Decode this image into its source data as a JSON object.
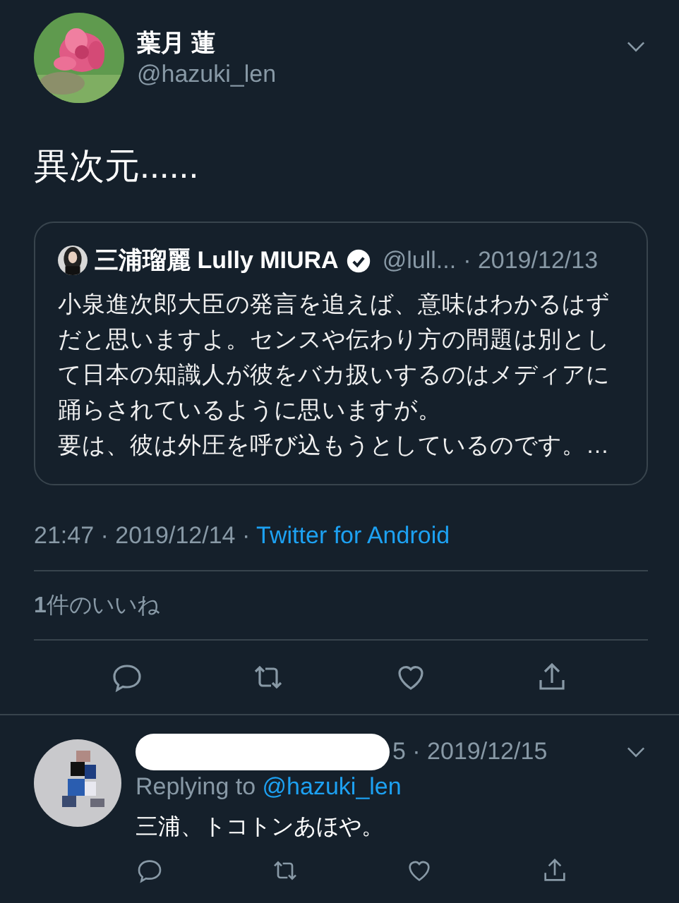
{
  "tweet": {
    "author": {
      "name": "葉月 蓮",
      "handle": "@hazuki_len"
    },
    "text": "異次元......",
    "quoted": {
      "author": "三浦瑠麗 Lully MIURA",
      "verified": true,
      "handle": "@lull...",
      "date": "· 2019/12/13",
      "paragraphs": [
        "小泉進次郎大臣の発言を追えば、意味はわかるはずだと思いますよ。センスや伝わり方の問題は別として日本の知識人が彼をバカ扱いするのはメディアに踊らされているように思いますが。",
        "要は、彼は外圧を呼び込もうとしているのです。…"
      ]
    },
    "meta": {
      "time": "21:47 · 2019/12/14 · ",
      "source": "Twitter for Android"
    },
    "likes": "**1**件のいいね"
  },
  "reply": {
    "date": "5 · 2019/12/15",
    "replying_label": "Replying to",
    "replying_handle": "@hazuki_len",
    "text": "三浦、トコトンあほや。"
  }
}
